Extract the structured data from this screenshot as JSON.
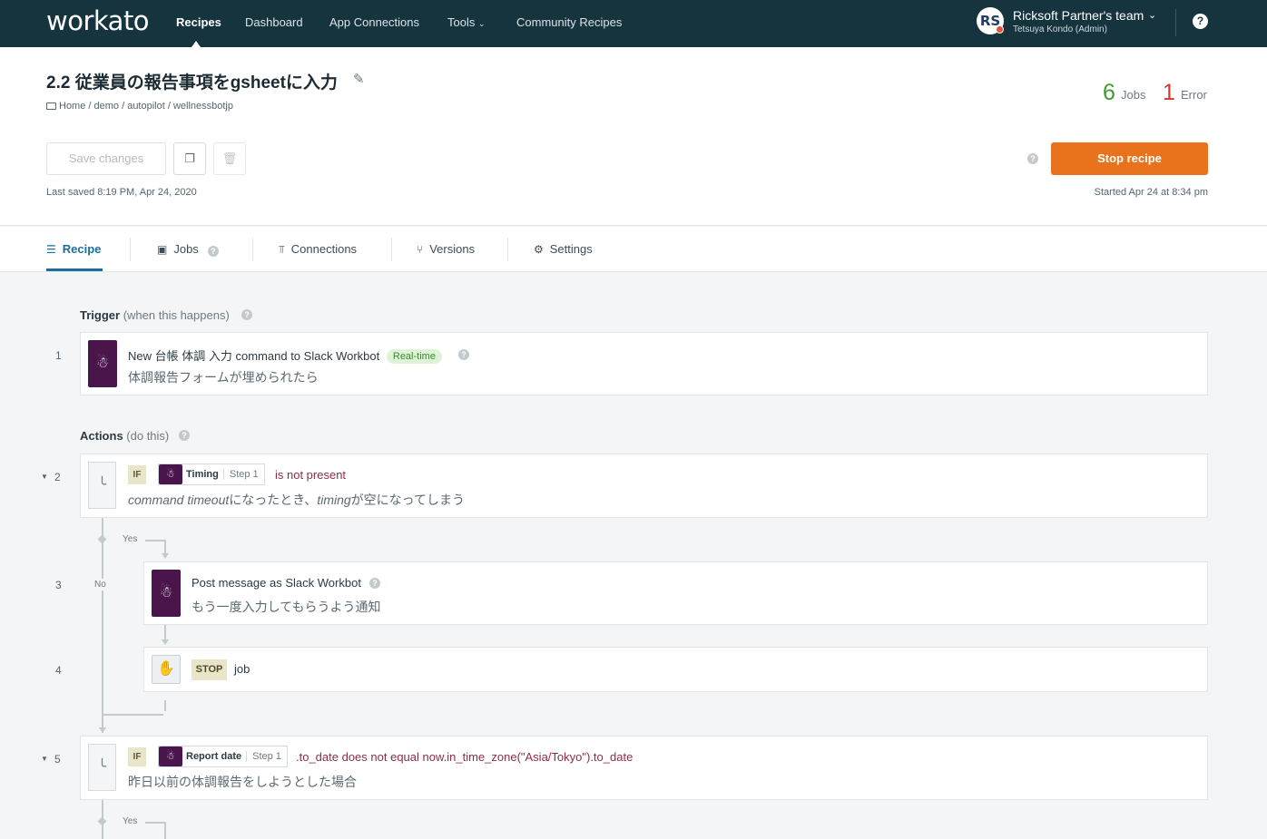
{
  "nav": {
    "logo": "workato",
    "links": [
      "Recipes",
      "Dashboard",
      "App Connections",
      "Tools",
      "Community Recipes"
    ],
    "team_name": "Ricksoft Partner's team",
    "team_user": "Tetsuya Kondo (Admin)",
    "avatar_text": "RS",
    "help": "?"
  },
  "recipe": {
    "title": "2.2 従業員の報告事項をgsheetに入力",
    "breadcrumb": "Home / demo / autopilot / wellnessbotjp",
    "jobs_count": "6",
    "jobs_label": "Jobs",
    "error_count": "1",
    "error_label": "Error",
    "save_label": "Save changes",
    "last_saved": "Last saved 8:19 PM, Apr 24, 2020",
    "stop_label": "Stop recipe",
    "started": "Started Apr 24 at 8:34 pm"
  },
  "tabs": [
    "Recipe",
    "Jobs",
    "Connections",
    "Versions",
    "Settings"
  ],
  "trigger": {
    "section_bold": "Trigger",
    "section_muted": "(when this happens)",
    "num": "1",
    "pre": "New",
    "cmd": "台帳 体調 入力",
    "mid": "command to",
    "app": "Slack Workbot",
    "badge": "Real-time",
    "desc": "体調報告フォームが埋められたら"
  },
  "actions": {
    "section_bold": "Actions",
    "section_muted": "(do this)"
  },
  "steps": [
    {
      "num": "2",
      "if": "IF",
      "pill": "Timing",
      "pill_step": "Step 1",
      "cond": "is not present",
      "desc_it1": "command timeout",
      "desc1": "になったとき、",
      "desc_it2": "timing",
      "desc2": "が空になってしまう"
    },
    {
      "num": "3",
      "pre": "Post message",
      "mid": "as",
      "app": "Slack Workbot",
      "desc": "もう一度入力してもらうよう通知"
    },
    {
      "num": "4",
      "badge": "STOP",
      "text": "job"
    },
    {
      "num": "5",
      "if": "IF",
      "pill": "Report date",
      "pill_step": "Step 1",
      "cond": ".to_date does not equal now.in_time_zone(\"Asia/Tokyo\").to_date",
      "desc": "昨日以前の体調報告をしようとした場合"
    }
  ],
  "branch": {
    "yes": "Yes",
    "no": "No"
  },
  "colors": {
    "nav_bg": "#15343d",
    "accent": "#1b6e9b",
    "stop": "#e8731c",
    "jobs": "#3f9a2e",
    "error": "#d0392b",
    "slack": "#4a154b"
  }
}
